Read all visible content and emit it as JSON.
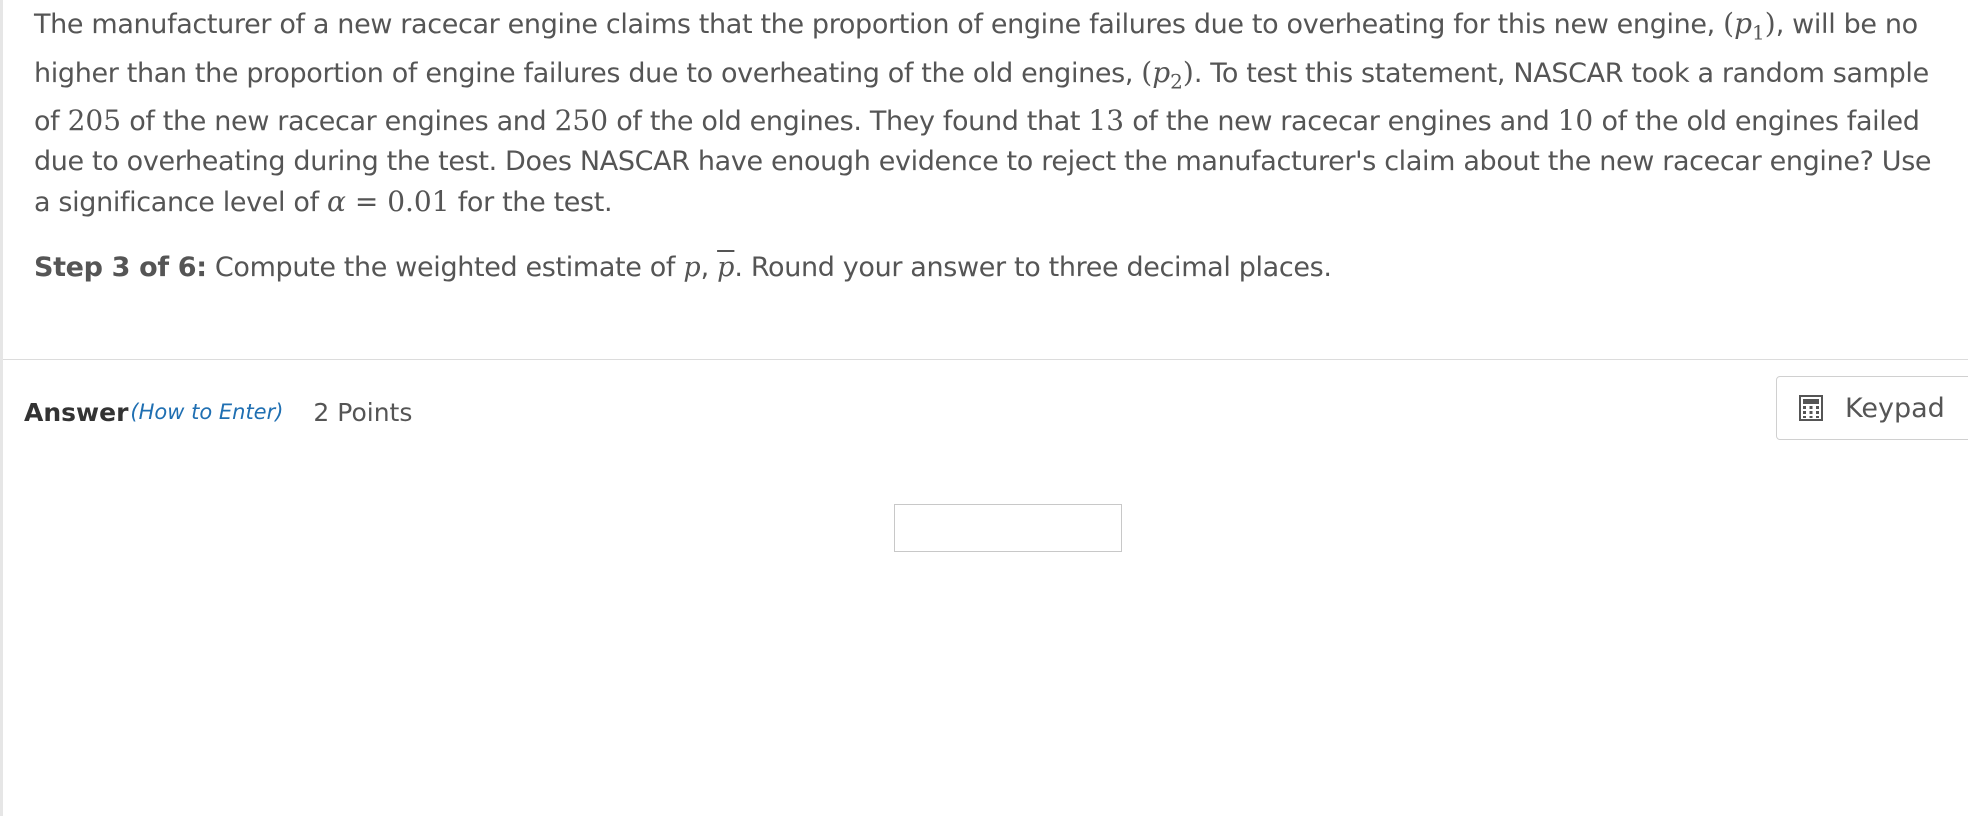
{
  "problem": {
    "t1": "The manufacturer of a new racecar engine claims that the proportion of engine failures due to overheating for this new engine, ",
    "p1_open": "(",
    "p1_var": "p",
    "p1_sub": "1",
    "p1_close": ")",
    "t2": ", will be no higher than the proportion of engine failures due to overheating of the old engines, ",
    "p2_open": "(",
    "p2_var": "p",
    "p2_sub": "2",
    "p2_close": ")",
    "t3": ". To test this statement, NASCAR took a random sample of ",
    "n1": "205",
    "t4": " of the new racecar engines and ",
    "n2": "250",
    "t5": " of the old engines. They found that ",
    "x1": "13",
    "t6": " of the new racecar engines and ",
    "x2": "10",
    "t7": " of the old engines failed due to overheating during the test. Does NASCAR have enough evidence to reject the manufacturer's claim about the new racecar engine? Use a significance level of ",
    "alpha_sym": "α",
    "eq": " = ",
    "alpha_val": "0.01",
    "t8": " for the test."
  },
  "step": {
    "label": "Step 3 of 6:",
    "t1": " Compute the weighted estimate of ",
    "p": "p",
    "comma": ", ",
    "pbar": "p",
    "t2": ". Round your answer to three decimal places."
  },
  "answer": {
    "label": "Answer",
    "how_to": "(How to Enter)",
    "points": "2 Points",
    "input_value": ""
  },
  "keypad": {
    "label": "Keypad",
    "icon": "calculator-icon"
  },
  "colors": {
    "text": "#555555",
    "label": "#333333",
    "link": "#1f6fb2",
    "border": "#d0d0d0"
  }
}
